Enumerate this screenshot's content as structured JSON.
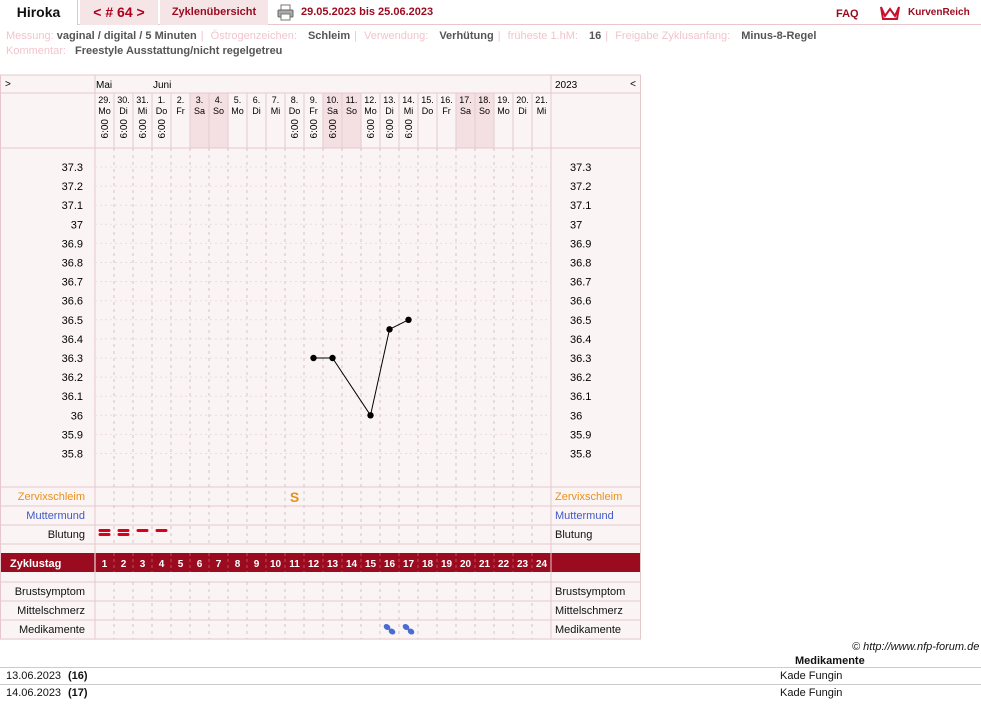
{
  "header": {
    "user": "Hiroka",
    "cycle_nav": {
      "prev": "<",
      "label": "# 64",
      "next": ">"
    },
    "overview": "Zyklenübersicht",
    "date_range": "29.05.2023 bis 25.06.2023",
    "faq": "FAQ",
    "logo_text": "KurvenReich"
  },
  "info": {
    "messung_label": "Messung:",
    "messung": "vaginal / digital / 5 Minuten",
    "oestrogen_label": "Östrogenzeichen:",
    "oestrogen": "Schleim",
    "verwendung_label": "Verwendung:",
    "verwendung": "Verhütung",
    "hm_label": "früheste 1.hM:",
    "hm": "16",
    "freigabe_label": "Freigabe Zyklusanfang:",
    "freigabe": "Minus-8-Regel",
    "kommentar_label": "Kommentar:",
    "kommentar": "Freestyle Ausstattung/nicht regelgetreu"
  },
  "chart_data": {
    "type": "line",
    "nav_left": ">",
    "nav_right": "<",
    "year": "2023",
    "months": [
      {
        "label": "Mai",
        "day": 0
      },
      {
        "label": "Juni",
        "day": 3
      }
    ],
    "days": [
      {
        "d": "29.",
        "w": "Mo",
        "t": "6:00",
        "we": false,
        "temp": null
      },
      {
        "d": "30.",
        "w": "Di",
        "t": "6:00",
        "we": false,
        "temp": null
      },
      {
        "d": "31.",
        "w": "Mi",
        "t": "6:00",
        "we": false,
        "temp": null
      },
      {
        "d": "1.",
        "w": "Do",
        "t": "6:00",
        "we": false,
        "temp": null
      },
      {
        "d": "2.",
        "w": "Fr",
        "t": "",
        "we": false,
        "temp": null
      },
      {
        "d": "3.",
        "w": "Sa",
        "t": "",
        "we": true,
        "temp": null
      },
      {
        "d": "4.",
        "w": "So",
        "t": "",
        "we": true,
        "temp": null
      },
      {
        "d": "5.",
        "w": "Mo",
        "t": "",
        "we": false,
        "temp": null
      },
      {
        "d": "6.",
        "w": "Di",
        "t": "",
        "we": false,
        "temp": null
      },
      {
        "d": "7.",
        "w": "Mi",
        "t": "",
        "we": false,
        "temp": null
      },
      {
        "d": "8.",
        "w": "Do",
        "t": "6:00",
        "we": false,
        "temp": null
      },
      {
        "d": "9.",
        "w": "Fr",
        "t": "6:00",
        "we": false,
        "temp": 36.3
      },
      {
        "d": "10.",
        "w": "Sa",
        "t": "6:00",
        "we": true,
        "temp": 36.3
      },
      {
        "d": "11.",
        "w": "So",
        "t": "",
        "we": true,
        "temp": null
      },
      {
        "d": "12.",
        "w": "Mo",
        "t": "6:00",
        "we": false,
        "temp": 36.0
      },
      {
        "d": "13.",
        "w": "Di",
        "t": "6:00",
        "we": false,
        "temp": 36.45
      },
      {
        "d": "14.",
        "w": "Mi",
        "t": "6:00",
        "we": false,
        "temp": 36.5
      },
      {
        "d": "15.",
        "w": "Do",
        "t": "",
        "we": false,
        "temp": null
      },
      {
        "d": "16.",
        "w": "Fr",
        "t": "",
        "we": false,
        "temp": null
      },
      {
        "d": "17.",
        "w": "Sa",
        "t": "",
        "we": true,
        "temp": null
      },
      {
        "d": "18.",
        "w": "So",
        "t": "",
        "we": true,
        "temp": null
      },
      {
        "d": "19.",
        "w": "Mo",
        "t": "",
        "we": false,
        "temp": null
      },
      {
        "d": "20.",
        "w": "Di",
        "t": "",
        "we": false,
        "temp": null
      },
      {
        "d": "21.",
        "w": "Mi",
        "t": "",
        "we": false,
        "temp": null
      }
    ],
    "y_ticks": [
      "37.3",
      "37.2",
      "37.1",
      "37",
      "36.9",
      "36.8",
      "36.7",
      "36.6",
      "36.5",
      "36.4",
      "36.3",
      "36.2",
      "36.1",
      "36",
      "35.9",
      "35.8"
    ],
    "ylim": [
      35.8,
      37.3
    ],
    "rows": {
      "zervix": "Zervixschleim",
      "muttermund": "Muttermund",
      "blutung": "Blutung",
      "zyklustag": "Zyklustag",
      "brust": "Brustsymptom",
      "mittel": "Mittelschmerz",
      "medi": "Medikamente"
    },
    "zervix_marks": [
      {
        "day": 10,
        "symbol": "S"
      }
    ],
    "blutung": [
      2,
      2,
      1,
      1
    ],
    "medication_days": [
      15,
      16
    ],
    "cycle_days": [
      "1",
      "2",
      "3",
      "4",
      "5",
      "6",
      "7",
      "8",
      "9",
      "10",
      "11",
      "12",
      "13",
      "14",
      "15",
      "16",
      "17",
      "18",
      "19",
      "20",
      "21",
      "22",
      "23",
      "24"
    ],
    "colors": {
      "accent": "#9a0b1f",
      "zervix": "#e8901a",
      "muttermund": "#3f59c4",
      "blutung": "#d8001a",
      "med": "#4a6bd0",
      "weekend": "#f4e0e3"
    }
  },
  "footer": {
    "copyright": "© http://www.nfp-forum.de",
    "med_header": "Medikamente",
    "med_rows": [
      {
        "date": "13.06.2023",
        "cd": "(16)",
        "med": "Kade Fungin"
      },
      {
        "date": "14.06.2023",
        "cd": "(17)",
        "med": "Kade Fungin"
      }
    ]
  }
}
